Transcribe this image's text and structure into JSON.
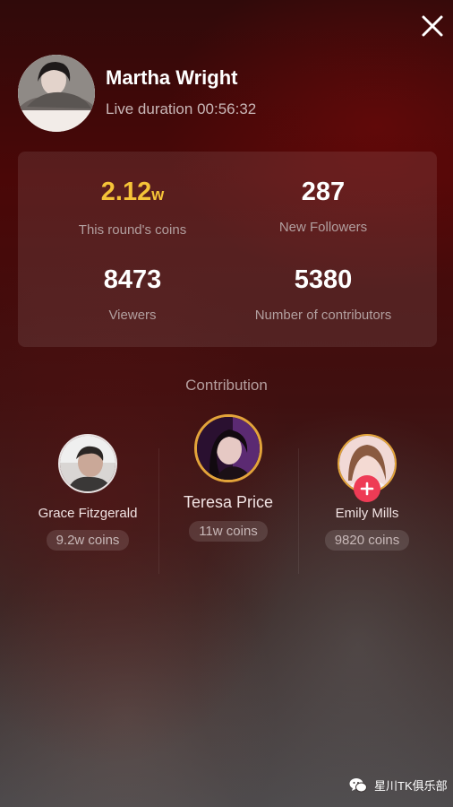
{
  "header": {
    "streamer_name": "Martha Wright",
    "live_duration": "Live duration 00:56:32"
  },
  "stats": {
    "coins": {
      "value": "2.12",
      "unit": "w",
      "label": "This round's coins"
    },
    "followers": {
      "value": "287",
      "label": "New Followers"
    },
    "viewers": {
      "value": "8473",
      "label": "Viewers"
    },
    "contributors": {
      "value": "5380",
      "label": "Number of contributors"
    }
  },
  "contribution": {
    "title": "Contribution",
    "items": [
      {
        "name": "Grace Fitzgerald",
        "coins": "9.2w coins"
      },
      {
        "name": "Teresa Price",
        "coins": "11w coins"
      },
      {
        "name": "Emily Mills",
        "coins": "9820 coins"
      }
    ]
  },
  "watermark": {
    "text": "星川TK俱乐部"
  },
  "icons": [
    "close-icon",
    "plus-icon",
    "wechat-icon"
  ],
  "colors": {
    "accent_gold": "#f5c338",
    "follow_red": "#ee3b55"
  }
}
